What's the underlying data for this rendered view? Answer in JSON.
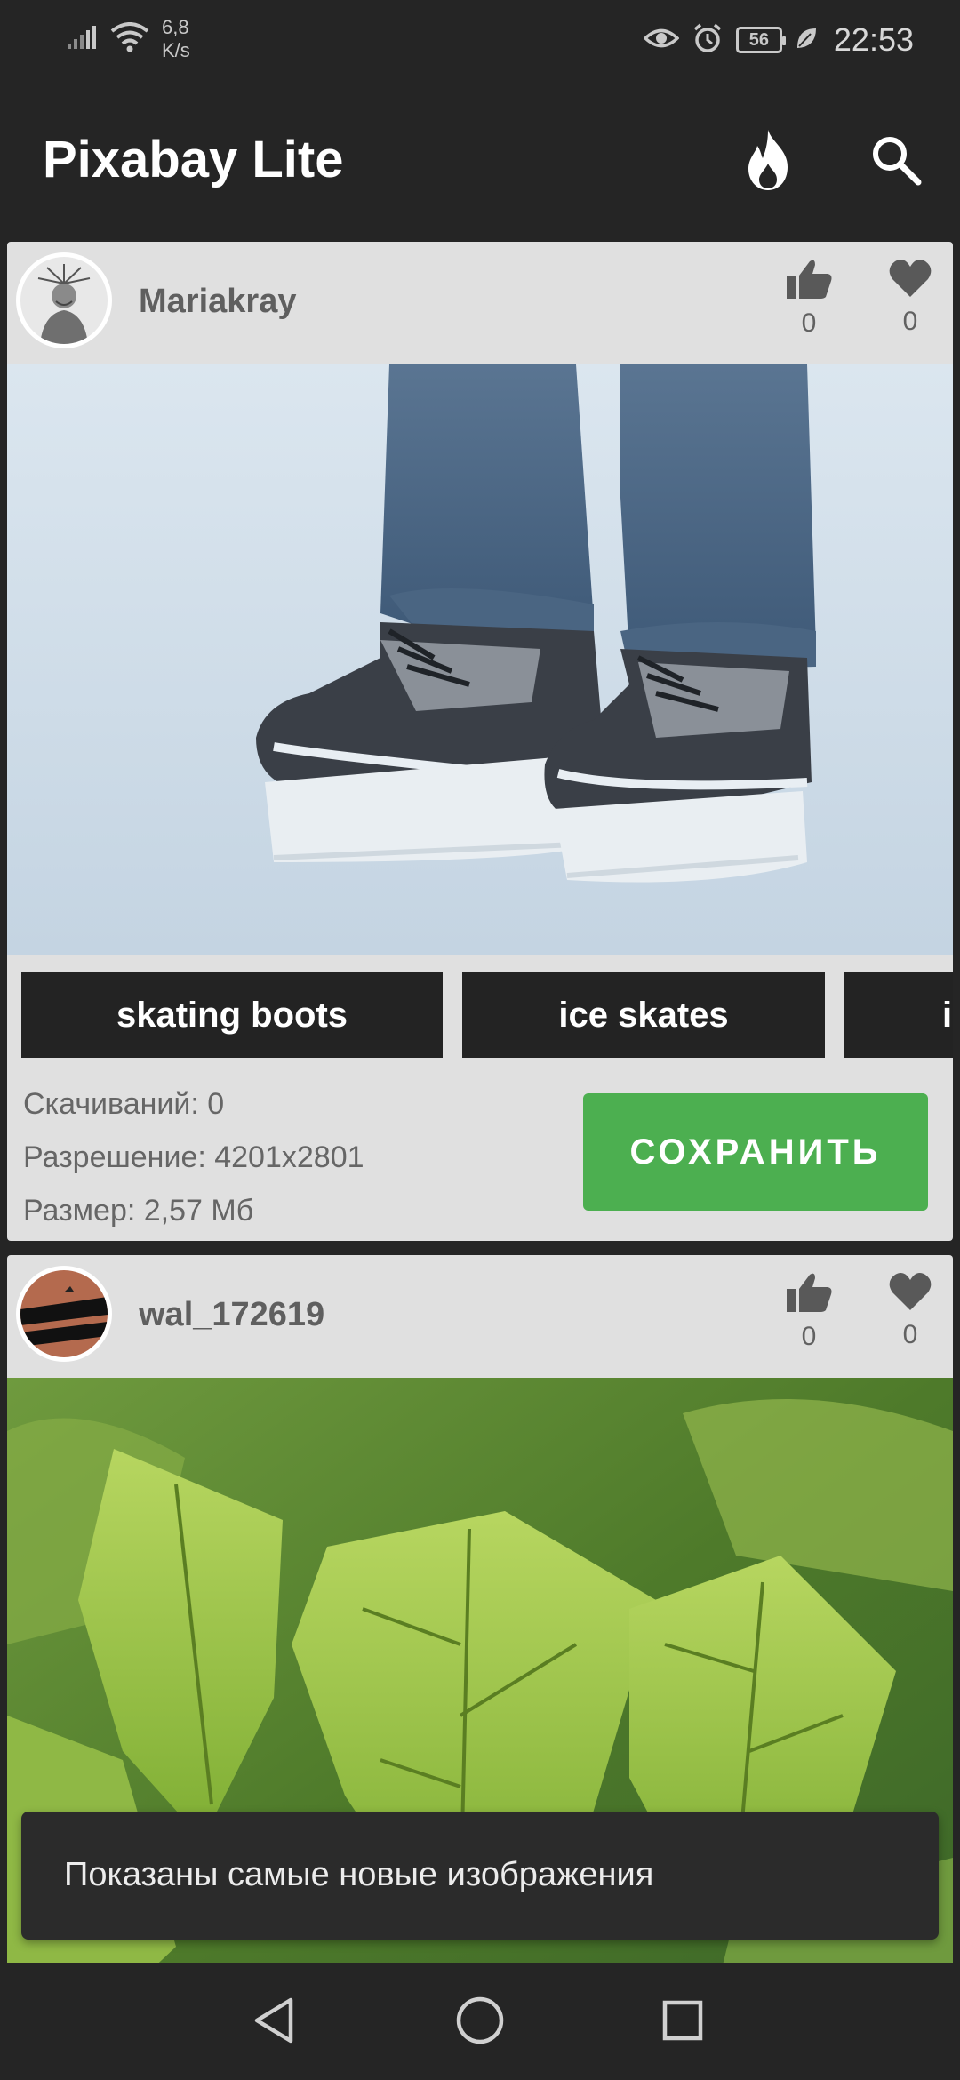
{
  "status_bar": {
    "network_speed_value": "6,8",
    "network_speed_unit": "K/s",
    "battery_level": "56",
    "time": "22:53",
    "icons": [
      "signal-icon",
      "wifi-icon",
      "eye-icon",
      "alarm-icon",
      "battery-icon",
      "leaf-icon"
    ]
  },
  "app_bar": {
    "title": "Pixabay Lite",
    "actions": [
      "fire-icon",
      "search-icon"
    ]
  },
  "posts": [
    {
      "username": "Mariakray",
      "likes": "0",
      "favorites": "0",
      "image_subject": "ice skates on ice",
      "tags": [
        "skating boots",
        "ice skates",
        "i"
      ],
      "downloads": "Скачиваний: 0",
      "resolution": "Разрешение: 4201x2801",
      "size": "Размер: 2,57 Мб",
      "save_label": "СОХРАНИТЬ"
    },
    {
      "username": "wal_172619",
      "likes": "0",
      "favorites": "0",
      "image_subject": "green leaves"
    }
  ],
  "snackbar": {
    "message": "Показаны самые новые изображения"
  },
  "colors": {
    "background": "#252525",
    "card": "#e0e0e0",
    "tag": "#232323",
    "save_button": "#4caf50"
  }
}
